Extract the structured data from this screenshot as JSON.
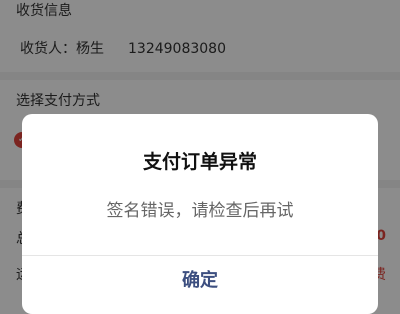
{
  "receiver": {
    "section_title": "收货信息",
    "label": "收货人：",
    "name": "杨生",
    "phone": "13249083080"
  },
  "payment": {
    "section_title": "选择支付方式",
    "selected_icon": "payment-method-icon"
  },
  "fees": {
    "section_title_partial": "费",
    "row1_label_partial": "总",
    "row1_value_partial": "0",
    "row2_label_partial": "运",
    "row2_value_partial": "费"
  },
  "dialog": {
    "title": "支付订单异常",
    "message": "签名错误，请检查后再试",
    "confirm_label": "确定"
  },
  "colors": {
    "accent_red": "#e0433b",
    "confirm_text": "#3d4f80"
  }
}
